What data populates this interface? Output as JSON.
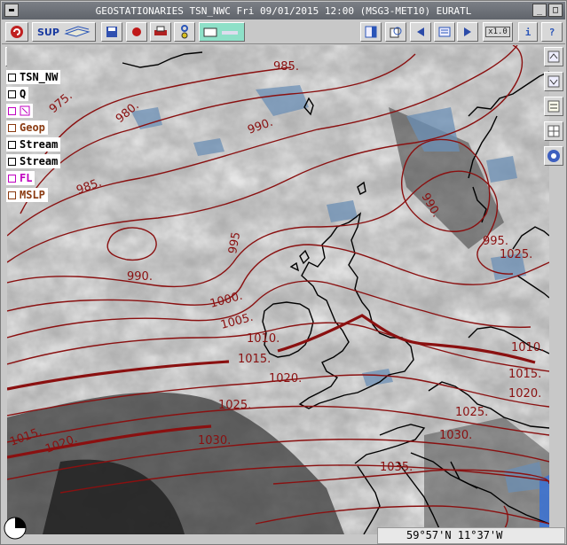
{
  "window": {
    "title": "GEOSTATIONARIES TSN_NWC Fri 09/01/2015 12:00 (MSG3-MET10) EURATL",
    "controls": [
      "_",
      "□",
      "×"
    ]
  },
  "toolbar": {
    "sup_label": "SUP",
    "zoom_label": "x1.0",
    "info_label": "i",
    "help_label": "?"
  },
  "legend": [
    {
      "label": "TSN_NW",
      "color": "#000000"
    },
    {
      "label": "Q",
      "color": "#000000"
    },
    {
      "label": "",
      "color": "#c000c0"
    },
    {
      "label": "Geop",
      "color": "#8a3a10"
    },
    {
      "label": "Stream",
      "color": "#000000"
    },
    {
      "label": "Stream",
      "color": "#000000"
    },
    {
      "label": "FL",
      "color": "#c000c0"
    },
    {
      "label": "MSLP",
      "color": "#8a3a10"
    }
  ],
  "isobars": [
    {
      "text": "975."
    },
    {
      "text": "980."
    },
    {
      "text": "985."
    },
    {
      "text": "985."
    },
    {
      "text": "990."
    },
    {
      "text": "990."
    },
    {
      "text": "995"
    },
    {
      "text": "1000."
    },
    {
      "text": "1005."
    },
    {
      "text": "1010."
    },
    {
      "text": "1015."
    },
    {
      "text": "1020."
    },
    {
      "text": "1025."
    },
    {
      "text": "1030."
    },
    {
      "text": "1035."
    },
    {
      "text": "1015."
    },
    {
      "text": "1020."
    },
    {
      "text": "1025."
    },
    {
      "text": "1030."
    },
    {
      "text": "990."
    },
    {
      "text": "995."
    },
    {
      "text": "1010."
    },
    {
      "text": "1015."
    },
    {
      "text": "1020."
    },
    {
      "text": "1025."
    },
    {
      "text": "995"
    }
  ],
  "status": {
    "coordinates": "59°57'N 11°37'W"
  },
  "colors": {
    "isobar": "#8a1010",
    "coast": "#000000",
    "toolbar_bg": "#c8c8c8",
    "title_bg": "#6b6f76"
  }
}
